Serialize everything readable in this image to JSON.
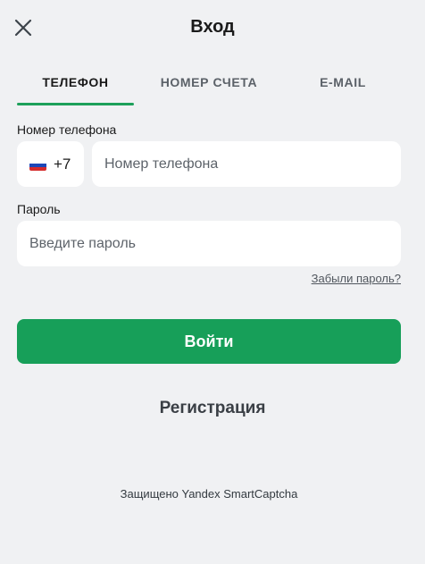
{
  "header": {
    "title": "Вход",
    "close_icon": "close-icon"
  },
  "tabs": [
    {
      "label": "ТЕЛЕФОН",
      "active": true
    },
    {
      "label": "НОМЕР СЧЕТА",
      "active": false
    },
    {
      "label": "E-MAIL",
      "active": false
    }
  ],
  "phone": {
    "label": "Номер телефона",
    "country_flag": "russia-flag-icon",
    "country_code": "+7",
    "placeholder": "Номер телефона",
    "value": ""
  },
  "password": {
    "label": "Пароль",
    "placeholder": "Введите пароль",
    "value": ""
  },
  "forgot_link": "Забыли пароль?",
  "login_button": "Войти",
  "register_link": "Регистрация",
  "captcha_note": "Защищено Yandex SmartCaptcha",
  "colors": {
    "accent": "#179f59",
    "tab_underline": "#1da05a",
    "background": "#f0f1f3"
  }
}
